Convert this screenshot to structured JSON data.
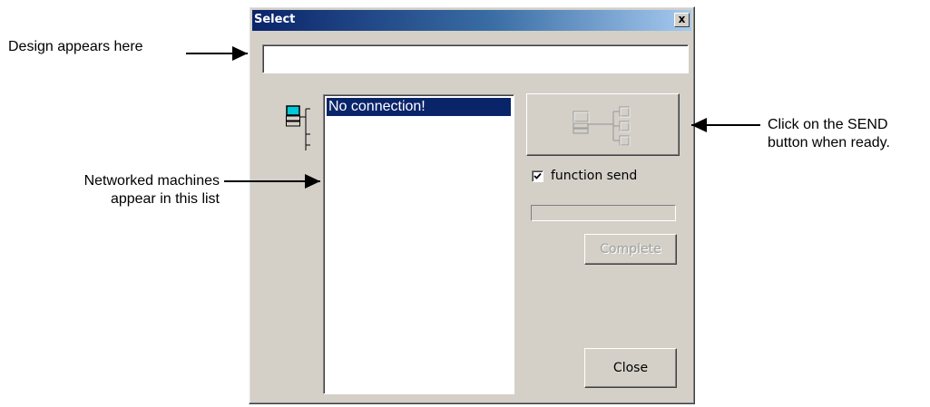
{
  "annotations": {
    "design": "Design appears here",
    "networked_line1": "Networked machines",
    "networked_line2": "appear in this list",
    "send_line1": "Click on the SEND",
    "send_line2": "button when ready."
  },
  "dialog": {
    "title": "Select",
    "close_glyph": "x",
    "design_field_value": "",
    "list": {
      "items": [
        "No connection!"
      ],
      "selected_index": 0
    },
    "send_button": {
      "icon": "network-send-icon"
    },
    "checkbox": {
      "label": "function send",
      "checked": true
    },
    "progress": {
      "value": 0
    },
    "complete_label": "Complete",
    "close_label": "Close"
  },
  "colors": {
    "dialog_bg": "#d4d0c8",
    "selection": "#0a246a",
    "title_gradient_start": "#0a246a",
    "title_gradient_end": "#a6caf0"
  }
}
